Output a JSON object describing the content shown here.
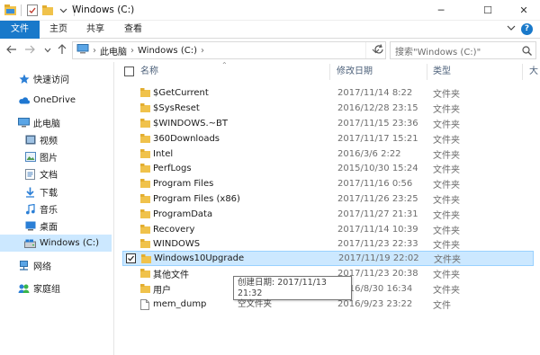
{
  "window": {
    "title": "Windows (C:)",
    "minimize": "─",
    "maximize": "☐",
    "close": "✕"
  },
  "ribbon": {
    "tabs": [
      "文件",
      "主页",
      "共享",
      "查看"
    ],
    "expand_icon": "chevron-down-icon",
    "help": "?"
  },
  "address": {
    "crumbs": [
      "此电脑",
      "Windows (C:)"
    ],
    "separator": "›",
    "search_placeholder": "搜索\"Windows (C:)\""
  },
  "nav": {
    "items": [
      {
        "label": "快速访问",
        "icon": "star-icon"
      },
      {
        "label": "OneDrive",
        "icon": "cloud-icon"
      },
      {
        "label": "此电脑",
        "icon": "computer-icon"
      },
      {
        "label": "视频",
        "icon": "video-icon"
      },
      {
        "label": "图片",
        "icon": "picture-icon"
      },
      {
        "label": "文档",
        "icon": "document-icon"
      },
      {
        "label": "下载",
        "icon": "download-icon"
      },
      {
        "label": "音乐",
        "icon": "music-icon"
      },
      {
        "label": "桌面",
        "icon": "desktop-icon"
      },
      {
        "label": "Windows (C:)",
        "icon": "drive-icon"
      },
      {
        "label": "网络",
        "icon": "network-icon"
      },
      {
        "label": "家庭组",
        "icon": "homegroup-icon"
      }
    ]
  },
  "columns": {
    "name": "名称",
    "date": "修改日期",
    "type": "类型",
    "size": "大"
  },
  "files": [
    {
      "name": "$GetCurrent",
      "date": "2017/11/14 8:22",
      "type": "文件夹",
      "icon": "folder-icon"
    },
    {
      "name": "$SysReset",
      "date": "2016/12/28 23:15",
      "type": "文件夹",
      "icon": "folder-icon"
    },
    {
      "name": "$WINDOWS.~BT",
      "date": "2017/11/15 23:36",
      "type": "文件夹",
      "icon": "folder-icon"
    },
    {
      "name": "360Downloads",
      "date": "2017/11/17 15:21",
      "type": "文件夹",
      "icon": "folder-icon"
    },
    {
      "name": "Intel",
      "date": "2016/3/6 2:22",
      "type": "文件夹",
      "icon": "folder-icon"
    },
    {
      "name": "PerfLogs",
      "date": "2015/10/30 15:24",
      "type": "文件夹",
      "icon": "folder-icon"
    },
    {
      "name": "Program Files",
      "date": "2017/11/16 0:56",
      "type": "文件夹",
      "icon": "folder-icon"
    },
    {
      "name": "Program Files (x86)",
      "date": "2017/11/26 23:25",
      "type": "文件夹",
      "icon": "folder-icon"
    },
    {
      "name": "ProgramData",
      "date": "2017/11/27 21:31",
      "type": "文件夹",
      "icon": "folder-icon"
    },
    {
      "name": "Recovery",
      "date": "2017/11/14 10:39",
      "type": "文件夹",
      "icon": "folder-icon"
    },
    {
      "name": "WINDOWS",
      "date": "2017/11/23 22:33",
      "type": "文件夹",
      "icon": "folder-icon"
    },
    {
      "name": "Windows10Upgrade",
      "date": "2017/11/19 22:02",
      "type": "文件夹",
      "icon": "folder-icon"
    },
    {
      "name": "其他文件",
      "date": "2017/11/23 20:38",
      "type": "文件夹",
      "icon": "folder-icon"
    },
    {
      "name": "用户",
      "date": "2016/8/30 16:34",
      "type": "文件夹",
      "icon": "folder-icon"
    },
    {
      "name": "mem_dump",
      "date": "2016/9/23 23:22",
      "type": "文件",
      "icon": "file-icon"
    }
  ],
  "tooltip": {
    "line1": "创建日期: 2017/11/13 21:32",
    "line2": "空文件夹"
  },
  "colors": {
    "accent": "#1979ca",
    "selection": "#cce8ff",
    "folder": "#f0c24b"
  }
}
